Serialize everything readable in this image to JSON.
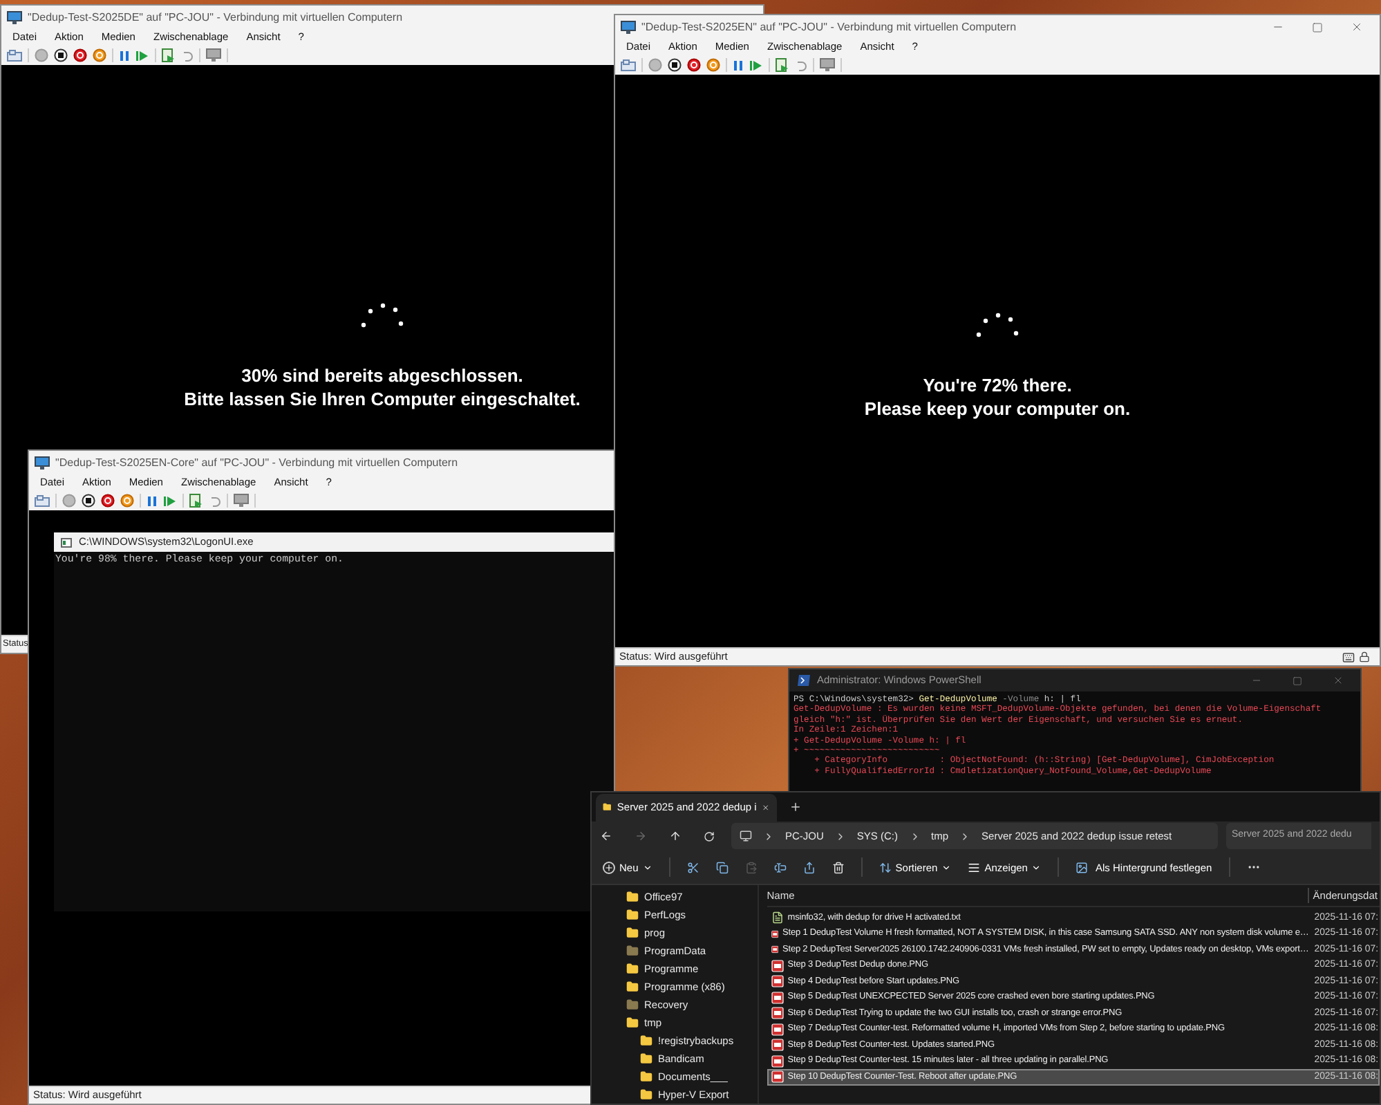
{
  "vm_windows": [
    {
      "title": "\"Dedup-Test-S2025DE\" auf \"PC-JOU\" - Verbindung mit virtuellen Computern",
      "menu": [
        "Datei",
        "Aktion",
        "Medien",
        "Zwischenablage",
        "Ansicht",
        "?"
      ],
      "screen": {
        "kind": "progress",
        "lines": [
          "30% sind bereits abgeschlossen.",
          "Bitte lassen Sie Ihren Computer eingeschaltet."
        ]
      },
      "status": "Status"
    },
    {
      "title": "\"Dedup-Test-S2025EN\" auf \"PC-JOU\" - Verbindung mit virtuellen Computern",
      "menu": [
        "Datei",
        "Aktion",
        "Medien",
        "Zwischenablage",
        "Ansicht",
        "?"
      ],
      "screen": {
        "kind": "progress",
        "lines": [
          "You're 72% there.",
          "Please keep your computer on."
        ]
      },
      "status": "Status: Wird ausgeführt"
    },
    {
      "title": "\"Dedup-Test-S2025EN-Core\" auf \"PC-JOU\" - Verbindung mit virtuellen Computern",
      "menu": [
        "Datei",
        "Aktion",
        "Medien",
        "Zwischenablage",
        "Ansicht",
        "?"
      ],
      "screen": {
        "kind": "console",
        "title": "C:\\WINDOWS\\system32\\LogonUI.exe",
        "lines": [
          "You're 98% there. Please keep your computer on."
        ]
      },
      "status": "Status: Wird ausgeführt"
    }
  ],
  "powershell": {
    "title": "Administrator: Windows PowerShell",
    "lines": [
      {
        "segments": [
          {
            "kind": "prompt",
            "text": "PS C:\\Windows\\system32> "
          },
          {
            "kind": "command",
            "text": "Get-DedupVolume"
          },
          {
            "kind": "parameter",
            "text": " -Volume"
          },
          {
            "kind": "prompt",
            "text": " h: | fl"
          }
        ]
      },
      {
        "segments": [
          {
            "kind": "error",
            "text": "Get-DedupVolume : Es wurden keine MSFT_DedupVolume-Objekte gefunden, bei denen die Volume-Eigenschaft"
          }
        ]
      },
      {
        "segments": [
          {
            "kind": "error",
            "text": "gleich \"h:\" ist. Überprüfen Sie den Wert der Eigenschaft, und versuchen Sie es erneut."
          }
        ]
      },
      {
        "segments": [
          {
            "kind": "error",
            "text": "In Zeile:1 Zeichen:1"
          }
        ]
      },
      {
        "segments": [
          {
            "kind": "error",
            "text": "+ Get-DedupVolume -Volume h: | fl"
          }
        ]
      },
      {
        "segments": [
          {
            "kind": "error",
            "text": "+ ~~~~~~~~~~~~~~~~~~~~~~~~~~"
          }
        ]
      },
      {
        "segments": [
          {
            "kind": "error",
            "text": "    + CategoryInfo          : ObjectNotFound: (h::String) [Get-DedupVolume], CimJobException"
          }
        ]
      },
      {
        "segments": [
          {
            "kind": "error",
            "text": "    + FullyQualifiedErrorId : CmdletizationQuery_NotFound_Volume,Get-DedupVolume"
          }
        ]
      }
    ]
  },
  "explorer": {
    "tab": "Server 2025 and 2022 dedup i",
    "breadcrumb": [
      "PC-JOU",
      "SYS (C:)",
      "tmp",
      "Server 2025 and 2022 dedup issue retest"
    ],
    "search": {
      "placeholder": "Server 2025 and 2022 dedu"
    },
    "toolbar": [
      "Neu",
      "Sortieren",
      "Anzeigen",
      "Als Hintergrund festlegen"
    ],
    "nav": [
      {
        "label": "Office97",
        "hidden": false
      },
      {
        "label": "PerfLogs",
        "hidden": false
      },
      {
        "label": "prog",
        "hidden": false
      },
      {
        "label": "ProgramData",
        "hidden": true
      },
      {
        "label": "Programme",
        "hidden": false
      },
      {
        "label": "Programme (x86)",
        "hidden": false
      },
      {
        "label": "Recovery",
        "hidden": true
      },
      {
        "label": "tmp",
        "hidden": false,
        "children": [
          {
            "label": "!registrybackups",
            "hidden": false
          },
          {
            "label": "Bandicam",
            "hidden": false
          },
          {
            "label": "Documents___",
            "hidden": false
          },
          {
            "label": "Hyper-V Export",
            "hidden": false
          }
        ]
      }
    ],
    "columns": [
      "Name",
      "Änderungsdat"
    ],
    "rows": [
      {
        "kind": "text",
        "name": "msinfo32, with dedup for drive H activated.txt",
        "date": "2025-11-16 07:",
        "selected": false
      },
      {
        "kind": "image",
        "name": "Step 1 DedupTest Volume H fresh formatted, NOT A SYSTEM DISK, in this case Samsung SATA SSD. ANY non system disk volume e…",
        "date": "2025-11-16 07:",
        "selected": false
      },
      {
        "kind": "image",
        "name": "Step 2 DedupTest Server2025 26100.1742.240906-0331 VMs fresh installed, PW set to empty, Updates ready on desktop, VMs export…",
        "date": "2025-11-16 07:",
        "selected": false
      },
      {
        "kind": "image",
        "name": "Step 3 DedupTest Dedup done.PNG",
        "date": "2025-11-16 07:",
        "selected": false
      },
      {
        "kind": "image",
        "name": "Step 4 DedupTest before Start updates.PNG",
        "date": "2025-11-16 07:",
        "selected": false
      },
      {
        "kind": "image",
        "name": "Step 5 DedupTest UNEXCPECTED Server 2025 core crashed even bore starting updates.PNG",
        "date": "2025-11-16 07:",
        "selected": false
      },
      {
        "kind": "image",
        "name": "Step 6 DedupTest Trying to update the two GUI installs too, crash or strange error.PNG",
        "date": "2025-11-16 07:",
        "selected": false
      },
      {
        "kind": "image",
        "name": "Step 7 DedupTest Counter-test. Reformatted volume H, imported VMs from Step 2, before starting to update.PNG",
        "date": "2025-11-16 08:",
        "selected": false
      },
      {
        "kind": "image",
        "name": "Step 8 DedupTest Counter-test. Updates started.PNG",
        "date": "2025-11-16 08:",
        "selected": false
      },
      {
        "kind": "image",
        "name": "Step 9 DedupTest Counter-test. 15 minutes later - all three updating in parallel.PNG",
        "date": "2025-11-16 08:",
        "selected": false
      },
      {
        "kind": "image",
        "name": "Step 10 DedupTest Counter-Test. Reboot after update.PNG",
        "date": "2025-11-16 08:",
        "selected": true
      }
    ]
  }
}
